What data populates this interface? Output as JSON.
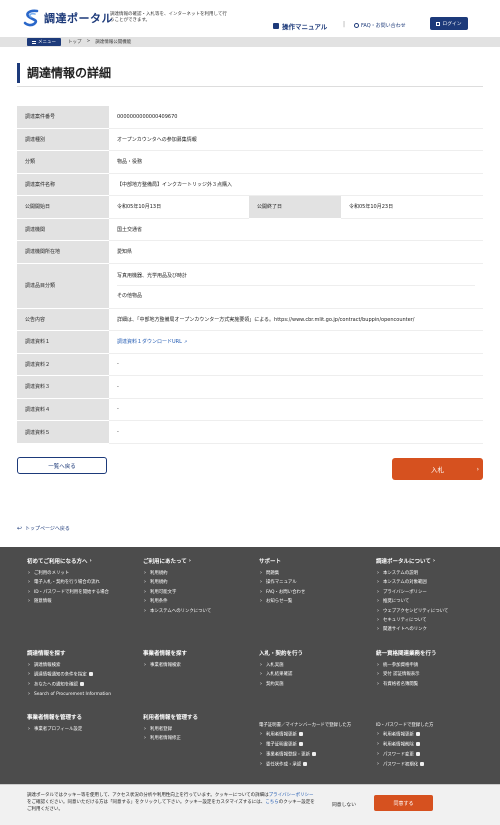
{
  "header": {
    "logo_text": "調達ポータル",
    "tagline": "調達情報の確認・入札等を、インターネットを利用して行うことができます。",
    "manual": "操作マニュアル",
    "faq": "FAQ・お問い合わせ",
    "login": "ログイン"
  },
  "breadcrumb": {
    "menu": "メニュー",
    "items": [
      "トップ",
      ">",
      "調達情報公開機能"
    ]
  },
  "page_title": "調達情報の詳細",
  "table": {
    "rows": [
      {
        "label": "調達案件番号",
        "value": "0000000000000409670"
      },
      {
        "label": "調達種別",
        "value": "オープンカウンタへの参加募集情報"
      },
      {
        "label": "分類",
        "value": "物品・役務"
      },
      {
        "label": "調達案件名称",
        "value": "【中部地方整備局】インクカートリッジ外３点購入"
      },
      {
        "label": "公開開始日",
        "value": "令和05年10月13日",
        "label2": "公開終了日",
        "value2": "令和05年10月23日"
      },
      {
        "label": "調達機関",
        "value": "国土交通省"
      },
      {
        "label": "調達機関所在地",
        "value": "愛知県"
      },
      {
        "label": "調達品目分類",
        "value": "写真用機器、光学用品及び時計",
        "value_b": "その他物品"
      },
      {
        "label": "公告内容",
        "value": "詳細は、「中部地方整備局オープンカウンター方式実施要領」による。https://www.cbr.mlit.go.jp/contract/buppin/opencounter/"
      },
      {
        "label": "調達資料１",
        "value": "調達資料１ダウンロードURL"
      },
      {
        "label": "調達資料２",
        "value": "-"
      },
      {
        "label": "調達資料３",
        "value": "-"
      },
      {
        "label": "調達資料４",
        "value": "-"
      },
      {
        "label": "調達資料５",
        "value": "-"
      }
    ]
  },
  "buttons": {
    "back": "一覧へ戻る",
    "bid": "入札",
    "top": "トップページへ戻る"
  },
  "footer": {
    "col1": {
      "title": "初めてご利用になる方へ",
      "items": [
        "ご利用のメリット",
        "電子入札・契約を行う場合の流れ",
        "ID・パスワードで利用を開始する場合",
        "随意情報"
      ]
    },
    "col2": {
      "title": "ご利用にあたって",
      "items": [
        "利用規約",
        "利用規約",
        "利用可能文字",
        "利用条件",
        "本システムへのリンクについて"
      ]
    },
    "col3": {
      "title": "サポート",
      "items": [
        "問題集",
        "操作マニュアル",
        "FAQ・お問い合わせ",
        "お知らせ一覧"
      ]
    },
    "col4": {
      "title": "調達ポータルについて",
      "items": [
        "本システムの説明",
        "本システムの対象範囲",
        "プライバシーポリシー",
        "推奨について",
        "ウェブアクセシビリティについて",
        "セキュリティについて",
        "関連サイトへのリンク"
      ]
    },
    "col5": {
      "title": "調達情報を探す",
      "items": [
        "調達情報検索",
        "調達情報通知の条件を指定",
        "あなたへの通知を確認",
        "Search of Procurement Information"
      ]
    },
    "col6": {
      "title": "事業者情報を探す",
      "items": [
        "事業者情報検索"
      ]
    },
    "col7": {
      "title": "入札・契約を行う",
      "items": [
        "入札実施",
        "入札結果確認",
        "契約実施"
      ]
    },
    "col8": {
      "title": "統一資格関連業務を行う",
      "items": [
        "統一参加資格申請",
        "受付 認証情報表示",
        "有資格者名簿閲覧"
      ]
    },
    "col9": {
      "title": "事業者情報を管理する",
      "items": [
        "事業者プロフィール設定"
      ]
    },
    "col10": {
      "title": "利用者情報を管理する",
      "items": [
        "利用者登録",
        "利用者情報修正"
      ]
    },
    "col11": {
      "subtitle": "電子証明書／マイナンバーカードで登録した方",
      "items": [
        "利用者情報更新",
        "電子証明書更新",
        "事業者情報登録・更新",
        "委任状作成・承認"
      ]
    },
    "col12": {
      "subtitle": "ID・パスワードで登録した方",
      "items": [
        "利用者情報更新",
        "利用者情報削除",
        "パスワード変更",
        "パスワード初期化"
      ]
    }
  },
  "cookie": {
    "text_before": "調達ポータルではクッキー等を使用して、アクセス状況の分析や利用性向上を行っています。クッキーについての詳細は",
    "policy_link": "プライバシーポリシー",
    "text_mid": "をご確認ください。同意いただける方は「同意する」をクリックして下さい。クッキー設定をカスタマイズするには、",
    "here_link": "こちら",
    "text_after": "のクッキー設定をご利用ください。",
    "reject": "同意しない",
    "agree": "同意する"
  },
  "colors": {
    "brand": "#1d3a7a",
    "accent": "#d6511f",
    "footer_bg": "#4c4c4c"
  }
}
